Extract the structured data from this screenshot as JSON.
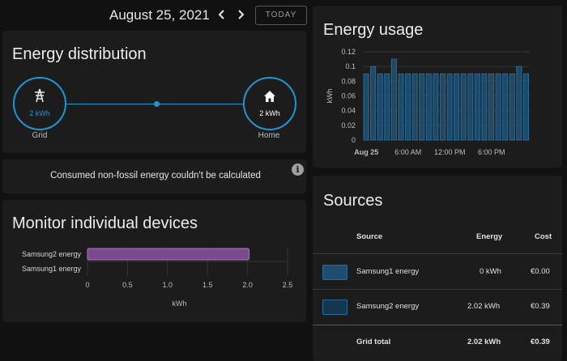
{
  "date_bar": {
    "date": "August 25, 2021",
    "prev_icon": "chevron-left-icon",
    "next_icon": "chevron-right-icon",
    "today_label": "TODAY"
  },
  "distribution": {
    "title": "Energy distribution",
    "grid": {
      "value": "2 kWh",
      "label": "Grid",
      "icon": "transmission-tower-icon"
    },
    "home": {
      "value": "2 kWh",
      "label": "Home",
      "icon": "home-icon"
    }
  },
  "info": {
    "message": "Consumed non-fossil energy couldn't be calculated",
    "icon": "info-icon"
  },
  "devices": {
    "title": "Monitor individual devices",
    "chart_data": {
      "type": "bar",
      "orientation": "horizontal",
      "categories": [
        "Samsung2 energy",
        "Samsung1 energy"
      ],
      "values": [
        2.02,
        0
      ],
      "xlabel": "kWh",
      "xlim": [
        0,
        2.5
      ],
      "ticks": [
        "0",
        "0.5",
        "1.0",
        "1.5",
        "2.0",
        "2.5"
      ],
      "bar_color": "#7b4a8c"
    }
  },
  "usage": {
    "title": "Energy usage",
    "chart_data": {
      "type": "bar",
      "ylabel": "kWh",
      "ylim": [
        0,
        0.12
      ],
      "yticks": [
        "0",
        "0.02",
        "0.04",
        "0.06",
        "0.08",
        "0.1",
        "0.12"
      ],
      "xticks": [
        "Aug 25",
        "6:00 AM",
        "12:00 PM",
        "6:00 PM"
      ],
      "values": [
        0.09,
        0.1,
        0.09,
        0.09,
        0.11,
        0.09,
        0.09,
        0.09,
        0.09,
        0.09,
        0.09,
        0.09,
        0.09,
        0.09,
        0.09,
        0.09,
        0.09,
        0.09,
        0.09,
        0.09,
        0.09,
        0.09,
        0.1,
        0.09
      ],
      "bar_color": "#1c4a6a",
      "bar_edge": "#2a6a96"
    }
  },
  "sources": {
    "title": "Sources",
    "headers": {
      "source": "Source",
      "energy": "Energy",
      "cost": "Cost"
    },
    "rows": [
      {
        "name": "Samsung1 energy",
        "energy": "0 kWh",
        "cost": "€0.00",
        "color": "#1d4e70"
      },
      {
        "name": "Samsung2 energy",
        "energy": "2.02 kWh",
        "cost": "€0.39",
        "color": "#163650"
      }
    ],
    "total": {
      "label": "Grid total",
      "energy": "2.02 kWh",
      "cost": "€0.39"
    }
  }
}
